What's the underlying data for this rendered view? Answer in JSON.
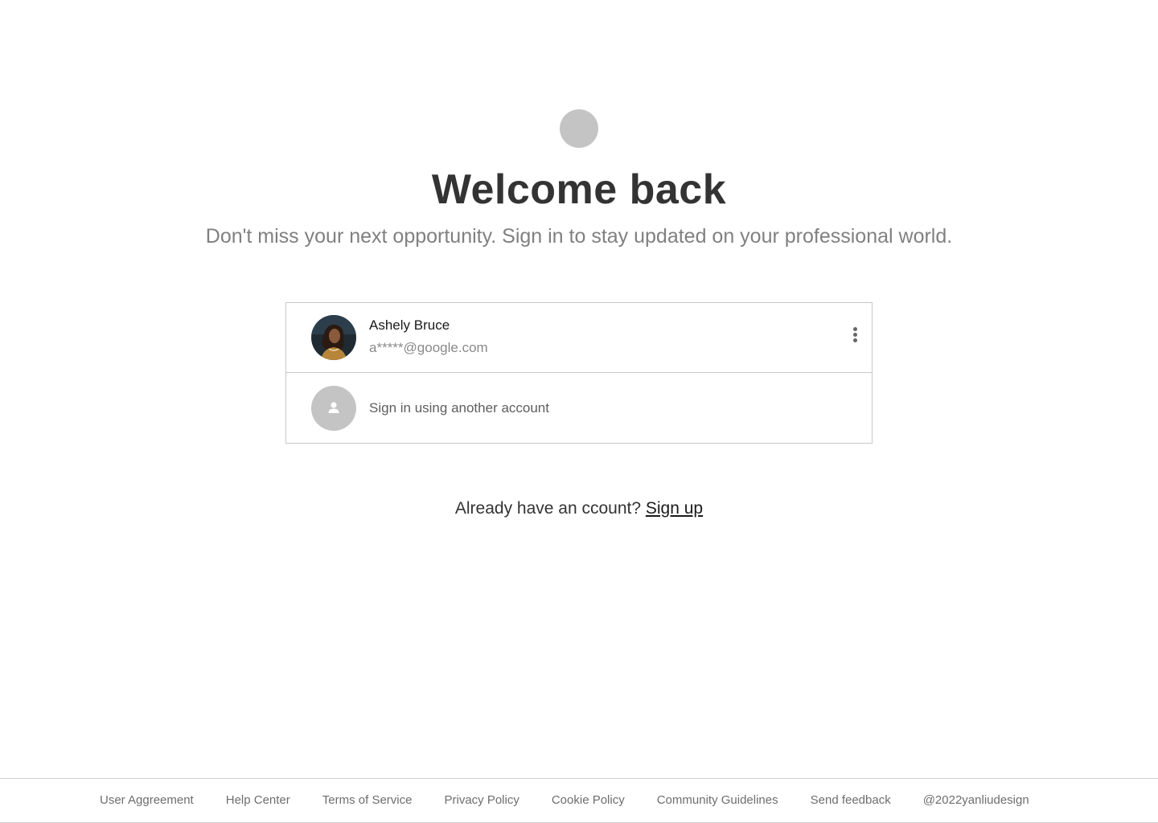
{
  "header": {
    "logo_icon": "app-logo-icon",
    "title": "Welcome back",
    "subtitle": "Don't miss your next opportunity. Sign in to stay updated on your professional world."
  },
  "accounts": {
    "saved": {
      "name": "Ashely Bruce",
      "email": "a*****@google.com",
      "avatar_icon": "user-photo",
      "menu_icon": "more-vertical-icon"
    },
    "another": {
      "label": "Sign in using another account",
      "icon": "person-icon"
    }
  },
  "signup": {
    "prompt": "Already have an ccount?",
    "link": "Sign up"
  },
  "footer": {
    "links": [
      "User Aggreement",
      "Help Center",
      "Terms of Service",
      "Privacy Policy",
      "Cookie Policy",
      "Community Guidelines",
      "Send feedback",
      "@2022yanliudesign"
    ]
  },
  "colors": {
    "background": "#ffffff",
    "placeholder_gray": "#c4c4c4",
    "title": "#333333",
    "subtitle": "#808080",
    "border": "#c8c8c8"
  }
}
